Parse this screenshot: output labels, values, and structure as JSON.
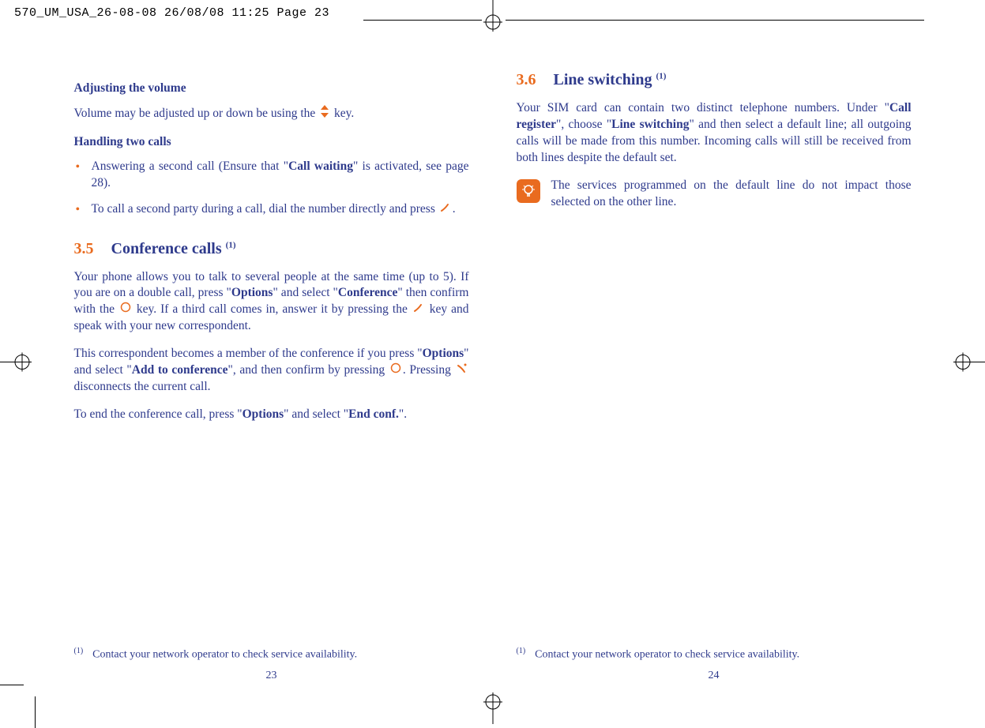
{
  "print_header": "570_UM_USA_26-08-08  26/08/08  11:25  Page 23",
  "left": {
    "h_adjusting": "Adjusting the volume",
    "p_adjusting_a": "Volume may be adjusted up or down be using the ",
    "p_adjusting_b": " key.",
    "h_handling": "Handling two calls",
    "bullet1_a": "Answering a second call (Ensure that \"",
    "bullet1_bold": "Call waiting",
    "bullet1_b": "\" is activated, see page 28).",
    "bullet2_a": "To call a second party during a call, dial the number directly and press ",
    "bullet2_b": ".",
    "sec_num": "3.5",
    "sec_title": "Conference calls ",
    "sec_sup": "(1)",
    "p1_a": "Your phone allows you to talk to several people at the same time (up to 5). If you are on a double call, press \"",
    "p1_b1": "Options",
    "p1_c": "\" and select \"",
    "p1_b2": "Conference",
    "p1_d": "\" then confirm with the ",
    "p1_e": " key. If a third call comes in, answer it by pressing the ",
    "p1_f": " key and speak with your new correspondent.",
    "p2_a": "This correspondent becomes a member of the conference if you press \"",
    "p2_b1": "Options",
    "p2_b": "\" and select \"",
    "p2_b2": "Add to conference",
    "p2_c": "\", and then confirm by pressing ",
    "p2_d": ". Pressing ",
    "p2_e": " disconnects the current call.",
    "p3_a": "To end the conference call, press \"",
    "p3_b1": "Options",
    "p3_b": "\" and select \"",
    "p3_b2": "End conf.",
    "p3_c": "\".",
    "fn_mark": "(1)",
    "fn_text": "Contact your network operator to check service availability.",
    "page_num": "23"
  },
  "right": {
    "sec_num": "3.6",
    "sec_title": "Line switching ",
    "sec_sup": "(1)",
    "p1_a": "Your SIM card can contain two distinct telephone numbers. Under \"",
    "p1_b1": "Call register",
    "p1_b": "\", choose \"",
    "p1_b2": "Line switching",
    "p1_c": "\" and then select a default line; all outgoing calls will be made from this number. Incoming calls will still be received from both lines despite the default set.",
    "note": "The services programmed on the default line do not impact those selected on the other line.",
    "fn_mark": "(1)",
    "fn_text": "Contact your network operator to check service availability.",
    "page_num": "24"
  }
}
